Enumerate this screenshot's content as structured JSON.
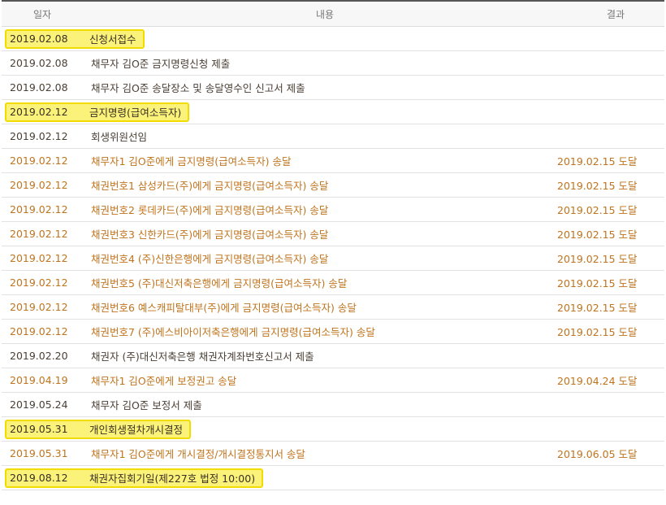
{
  "header": {
    "date": "일자",
    "content": "내용",
    "result": "결과"
  },
  "rows": [
    {
      "date": "2019.02.08",
      "content": "신청서접수",
      "result": ""
    },
    {
      "date": "2019.02.08",
      "content": "채무자 김O준 금지명령신청 제출",
      "result": ""
    },
    {
      "date": "2019.02.08",
      "content": "채무자 김O준 송달장소 및 송달영수인 신고서 제출",
      "result": ""
    },
    {
      "date": "2019.02.12",
      "content": "금지명령(급여소득자)",
      "result": ""
    },
    {
      "date": "2019.02.12",
      "content": "회생위원선임",
      "result": ""
    },
    {
      "date": "2019.02.12",
      "content": "채무자1 김O준에게 금지명령(급여소득자) 송달",
      "result": "2019.02.15 도달"
    },
    {
      "date": "2019.02.12",
      "content": "채권번호1 삼성카드(주)에게 금지명령(급여소득자) 송달",
      "result": "2019.02.15 도달"
    },
    {
      "date": "2019.02.12",
      "content": "채권번호2 롯데카드(주)에게 금지명령(급여소득자) 송달",
      "result": "2019.02.15 도달"
    },
    {
      "date": "2019.02.12",
      "content": "채권번호3 신한카드(주)에게 금지명령(급여소득자) 송달",
      "result": "2019.02.15 도달"
    },
    {
      "date": "2019.02.12",
      "content": "채권번호4 (주)신한은행에게 금지명령(급여소득자) 송달",
      "result": "2019.02.15 도달"
    },
    {
      "date": "2019.02.12",
      "content": "채권번호5 (주)대신저축은행에게 금지명령(급여소득자) 송달",
      "result": "2019.02.15 도달"
    },
    {
      "date": "2019.02.12",
      "content": "채권번호6 예스캐피탈대부(주)에게 금지명령(급여소득자) 송달",
      "result": "2019.02.15 도달"
    },
    {
      "date": "2019.02.12",
      "content": "채권번호7 (주)에스비아이저축은행에게 금지명령(급여소득자) 송달",
      "result": "2019.02.15 도달"
    },
    {
      "date": "2019.02.20",
      "content": "채권자 (주)대신저축은행 채권자계좌번호신고서 제출",
      "result": ""
    },
    {
      "date": "2019.04.19",
      "content": "채무자1 김O준에게 보정권고 송달",
      "result": "2019.04.24 도달"
    },
    {
      "date": "2019.05.24",
      "content": "채무자 김O준 보정서 제출",
      "result": ""
    },
    {
      "date": "2019.05.31",
      "content": "개인회생절차개시결정",
      "result": ""
    },
    {
      "date": "2019.05.31",
      "content": "채무자1 김O준에게 개시결정/개시결정통지서 송달",
      "result": "2019.06.05 도달"
    },
    {
      "date": "2019.08.12",
      "content": "채권자집회기일(제227호 법정 10:00)",
      "result": ""
    }
  ]
}
